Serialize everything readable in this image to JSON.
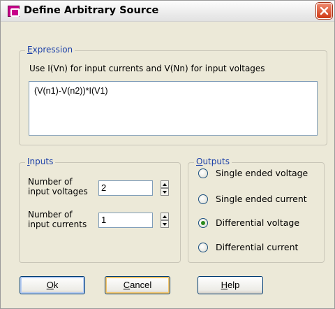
{
  "window": {
    "title": "Define Arbitrary Source",
    "app_icon": "arbitrary-source-icon",
    "close_icon": "close-icon"
  },
  "expression": {
    "legend_accel": "E",
    "legend_rest": "xpression",
    "hint": "Use I(Vn) for input currents and V(Nn) for input voltages",
    "value": "(V(n1)-V(n2))*I(V1)"
  },
  "inputs": {
    "legend_accel": "I",
    "legend_rest": "nputs",
    "voltages": {
      "label_line1": "Number of",
      "label_line2": "input voltages",
      "value": "2"
    },
    "currents": {
      "label_line1": "Number of",
      "label_line2": "input currents",
      "value": "1"
    }
  },
  "outputs": {
    "legend_accel": "O",
    "legend_rest": "utputs",
    "options": [
      {
        "label": "Single ended voltage",
        "checked": false
      },
      {
        "label": "Single ended current",
        "checked": false
      },
      {
        "label": "Differential voltage",
        "checked": true
      },
      {
        "label": "Differential current",
        "checked": false
      }
    ]
  },
  "buttons": {
    "ok": {
      "accel": "O",
      "rest": "k"
    },
    "cancel": {
      "accel": "C",
      "rest": "ancel"
    },
    "help": {
      "accel": "H",
      "rest": "elp"
    }
  },
  "colors": {
    "legend_text": "#1a3fa8",
    "dialog_bg": "#ece9d8",
    "radio_dot": "#2b8a1e",
    "close_button": "#cf3a18"
  }
}
